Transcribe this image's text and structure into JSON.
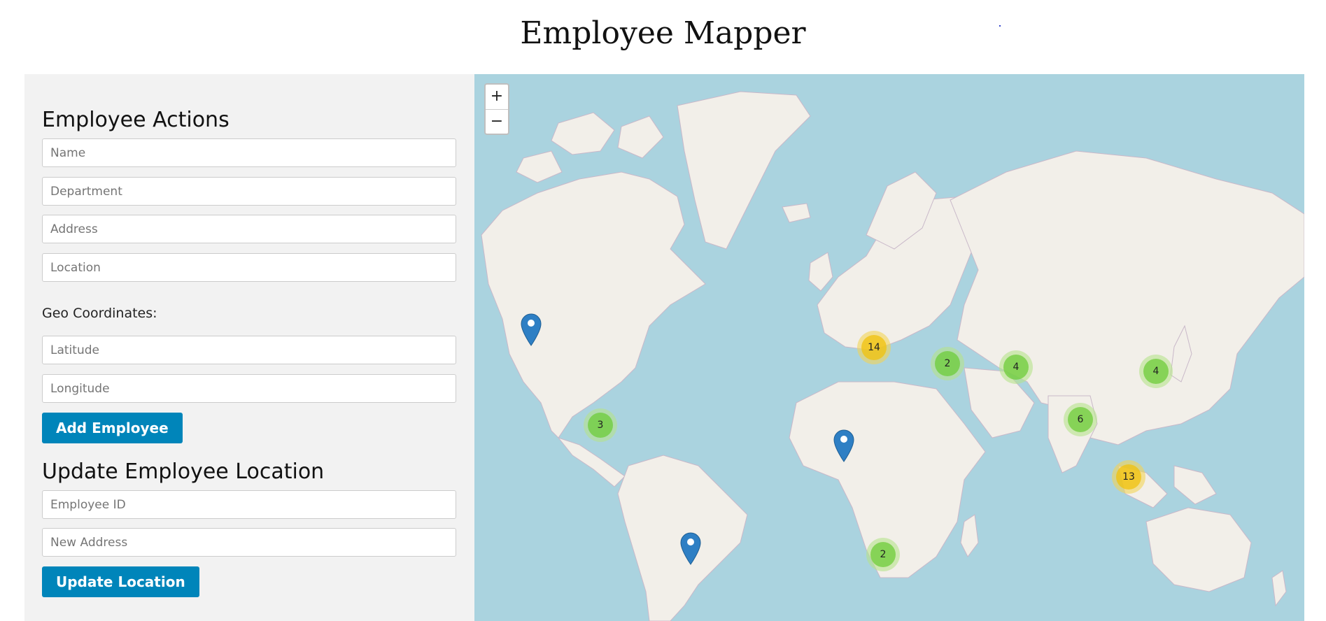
{
  "page": {
    "title": "Employee Mapper"
  },
  "employee_actions": {
    "heading": "Employee Actions",
    "name_placeholder": "Name",
    "department_placeholder": "Department",
    "address_placeholder": "Address",
    "location_placeholder": "Location",
    "geo_label": "Geo Coordinates:",
    "latitude_placeholder": "Latitude",
    "longitude_placeholder": "Longitude",
    "add_button": "Add Employee"
  },
  "update_location": {
    "heading": "Update Employee Location",
    "employee_id_placeholder": "Employee ID",
    "new_address_placeholder": "New Address",
    "update_button": "Update Location"
  },
  "map": {
    "zoom_in": "+",
    "zoom_out": "−",
    "clusters": [
      {
        "count": "14",
        "size": "medium"
      },
      {
        "count": "2",
        "size": "small"
      },
      {
        "count": "4",
        "size": "small"
      },
      {
        "count": "4",
        "size": "small"
      },
      {
        "count": "3",
        "size": "small"
      },
      {
        "count": "6",
        "size": "small"
      },
      {
        "count": "13",
        "size": "medium"
      },
      {
        "count": "2",
        "size": "small"
      }
    ],
    "markers": [
      {
        "icon": "map-pin-icon"
      },
      {
        "icon": "map-pin-icon"
      },
      {
        "icon": "map-pin-icon"
      }
    ],
    "colors": {
      "water": "#aad3df",
      "land": "#f2efe9",
      "border": "#c9b8c9"
    }
  },
  "colors": {
    "primary_button": "#0085ba",
    "sidebar_bg": "#f2f2f2"
  }
}
